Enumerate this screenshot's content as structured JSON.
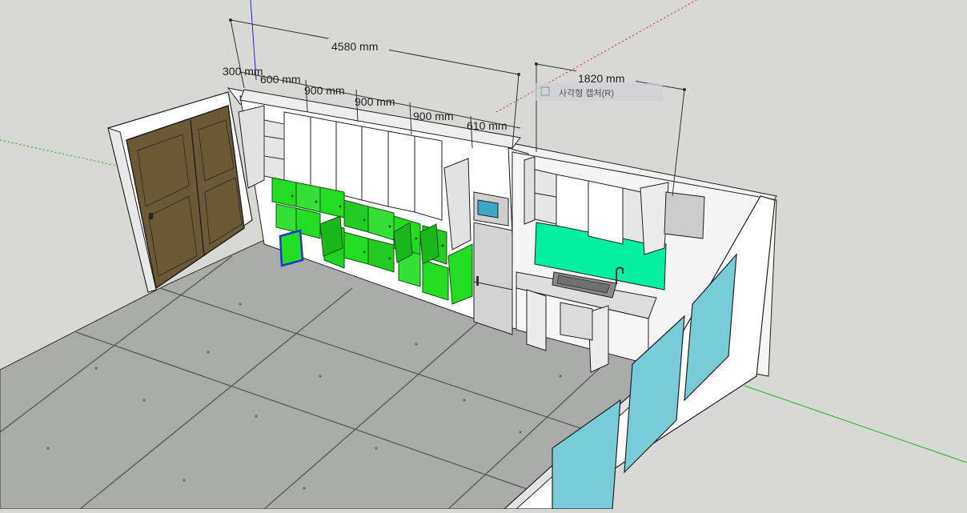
{
  "scene": {
    "background": "#d8d8d4",
    "floor_color": "#a9aba8",
    "cabinet_green": "#22dd22",
    "backsplash_green": "#00f0a0",
    "glass_color": "#78ccd8",
    "door_color": "#6b5a34",
    "wall_color": "#ffffff"
  },
  "dimensions": {
    "total": "4580 mm",
    "depth": "300 mm",
    "seg1": "600 mm",
    "seg2": "900 mm",
    "seg3": "900 mm",
    "seg4": "900 mm",
    "seg5": "610 mm",
    "kitchen": "1820 mm"
  },
  "tooltip": "사각형 캡처(R)",
  "icons": {
    "door": "door-icon",
    "sink": "sink-icon",
    "microwave": "microwave-icon",
    "refrigerator": "refrigerator-icon"
  }
}
